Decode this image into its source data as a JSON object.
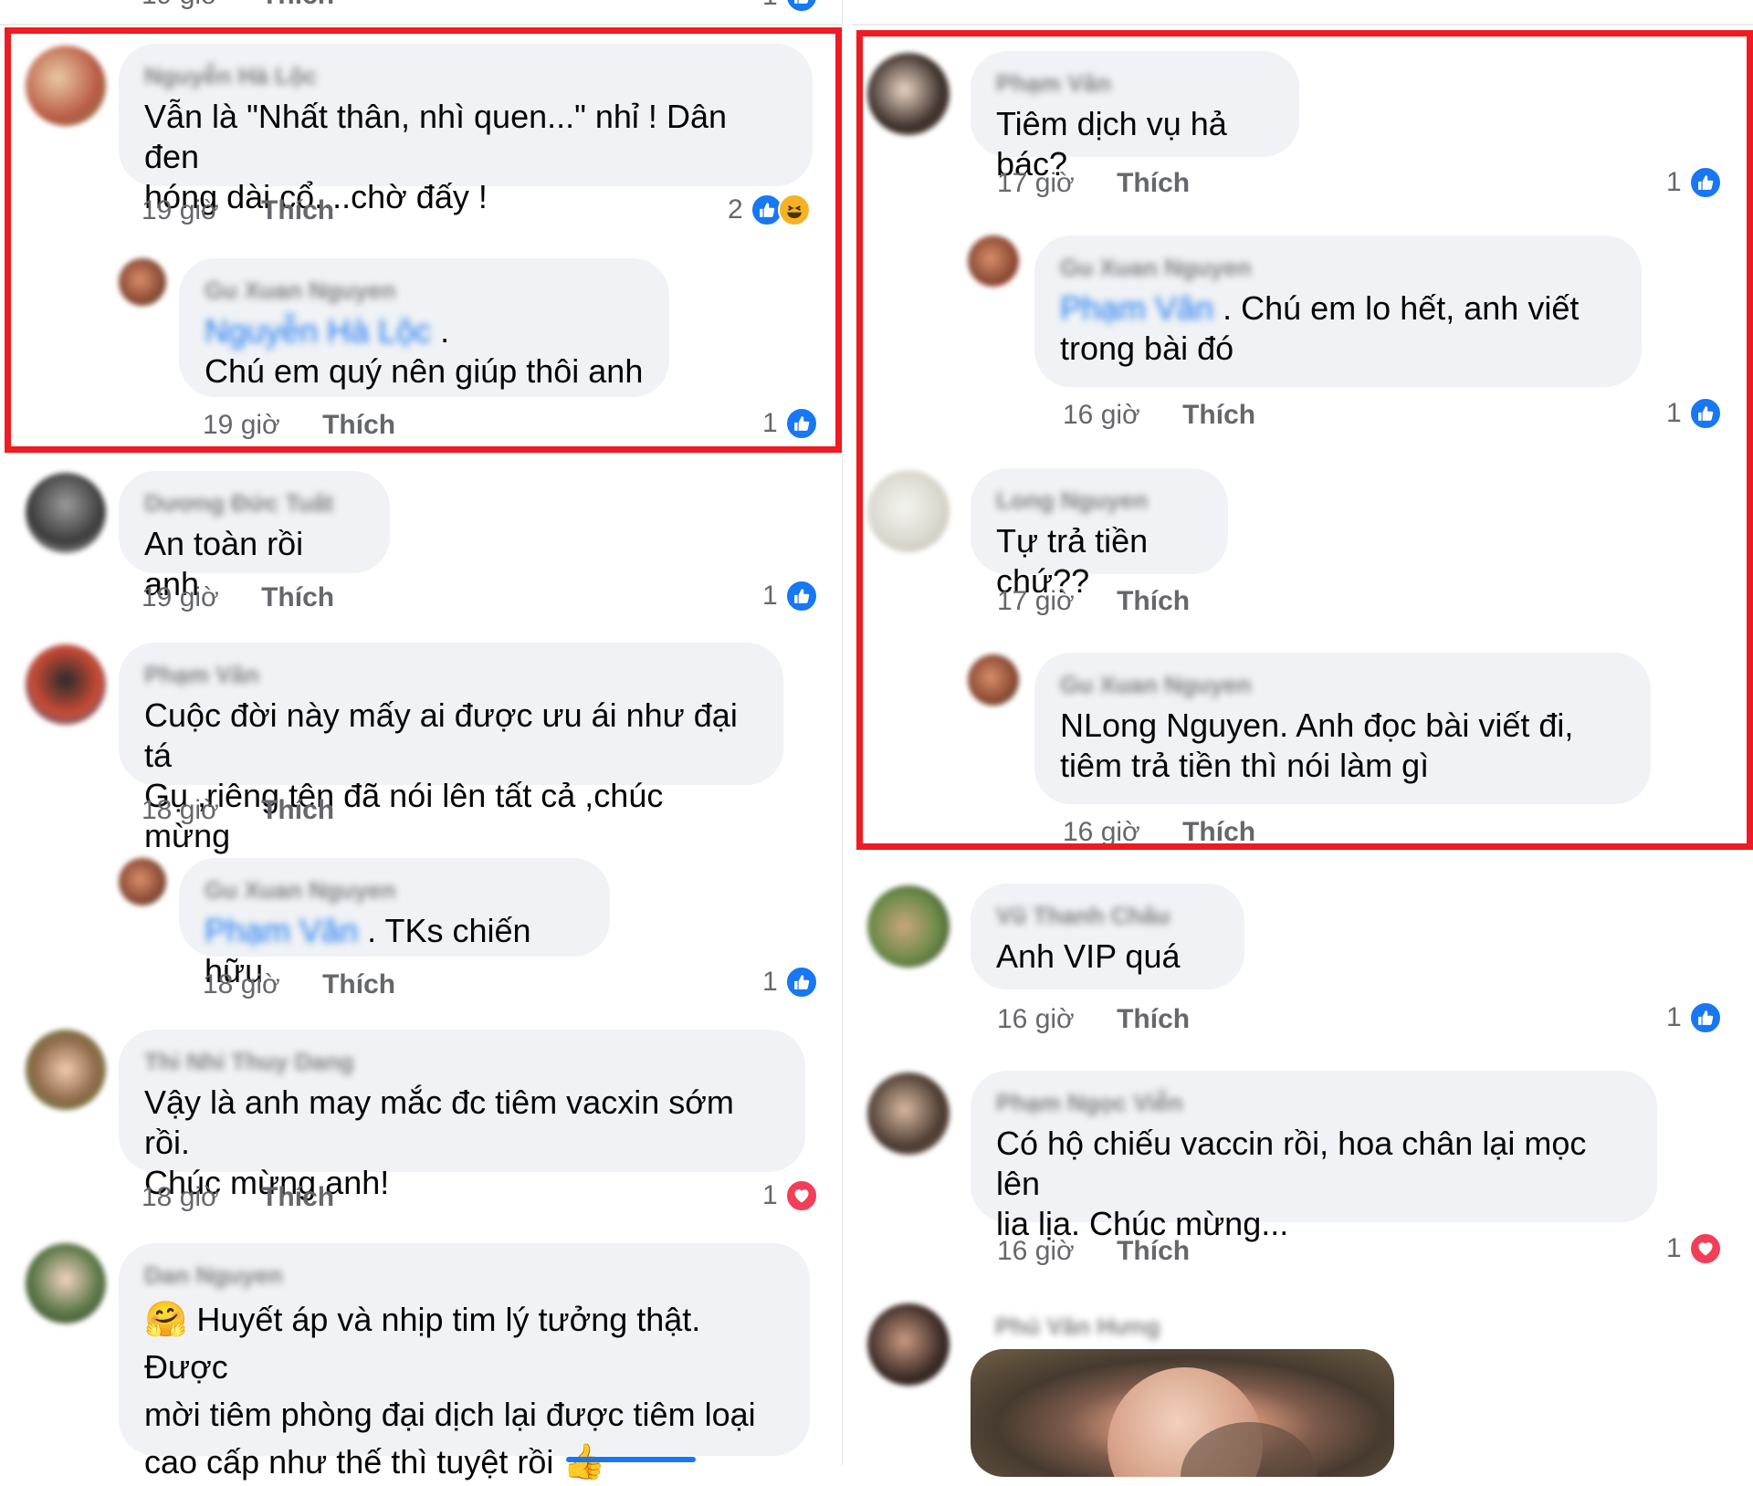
{
  "colors": {
    "highlight": "#ee1b22",
    "like_blue": "#1877f2",
    "heart_red": "#f33e58",
    "bubble_bg": "#f0f2f5",
    "meta_gray": "#65676b"
  },
  "top_partial": {
    "time": "19 giờ",
    "like": "Thích",
    "count": "1"
  },
  "left": [
    {
      "author": "Nguyễn Hà Lộc",
      "text": "Vẫn là \"Nhất thân, nhì quen...\" nhỉ ! Dân đen\nhóng dài cổ....chờ đấy !",
      "time": "19 giờ",
      "like": "Thích",
      "count": "2",
      "reactions": [
        "like-icon",
        "haha-icon"
      ]
    },
    {
      "author": "Gu Xuan Nguyen",
      "mention": "Nguyễn Hà Lộc",
      "mention_suffix": " .",
      "text": "Chú em quý nên giúp thôi anh",
      "time": "19 giờ",
      "like": "Thích",
      "count": "1",
      "reactions": [
        "like-icon"
      ]
    },
    {
      "author": "Dương Đức Tuất",
      "text": "An toàn rồi anh",
      "time": "19 giờ",
      "like": "Thích",
      "count": "1",
      "reactions": [
        "like-icon"
      ]
    },
    {
      "author": "Phạm Vân",
      "text": "Cuộc đời này mấy ai được ưu ái như đại tá\nGụ ,riêng tên đã nói lên tất cả ,chúc mừng",
      "time": "18 giờ",
      "like": "Thích"
    },
    {
      "author": "Gu Xuan Nguyen",
      "mention": "Phạm Vân",
      "text": ". TKs chiến hữu",
      "time": "18 giờ",
      "like": "Thích",
      "count": "1",
      "reactions": [
        "like-icon"
      ]
    },
    {
      "author": "Thi Nhi Thuy Dang",
      "text": "Vậy là anh may mắc đc tiêm vacxin sớm rồi.\nChúc mừng anh!",
      "time": "18 giờ",
      "like": "Thích",
      "count": "1",
      "reactions": [
        "heart-icon"
      ]
    },
    {
      "author": "Dan Nguyen",
      "emoji_start": "🤗",
      "text": " Huyết áp và nhịp tim lý tưởng thật. Được\nmời tiêm phòng đại dịch lại được tiêm loại\ncao cấp như thế thì tuyệt rồi ",
      "emoji_end": "👍"
    }
  ],
  "right": [
    {
      "author": "Phạm Vân",
      "text": "Tiêm dịch vụ hả bác?",
      "time": "17 giờ",
      "like": "Thích",
      "count": "1",
      "reactions": [
        "like-icon"
      ]
    },
    {
      "author": "Gu Xuan Nguyen",
      "mention": "Phạm Vân",
      "text": ". Chú em lo hết, anh viết\ntrong bài đó",
      "time": "16 giờ",
      "like": "Thích",
      "count": "1",
      "reactions": [
        "like-icon"
      ]
    },
    {
      "author": "Long Nguyen",
      "text": "Tự trả tiền chứ??",
      "time": "17 giờ",
      "like": "Thích"
    },
    {
      "author": "Gu Xuan Nguyen",
      "text": "NLong Nguyen. Anh đọc bài viết đi,\ntiêm trả tiền thì nói làm gì",
      "time": "16 giờ",
      "like": "Thích"
    },
    {
      "author": "Vũ Thanh Châu",
      "text": "Anh VIP quá",
      "time": "16 giờ",
      "like": "Thích",
      "count": "1",
      "reactions": [
        "like-icon"
      ]
    },
    {
      "author": "Phạm Ngọc Viễn",
      "text": "Có hộ chiếu vaccin rồi, hoa chân lại mọc lên\nlia lịa. Chúc mừng...",
      "time": "16 giờ",
      "like": "Thích",
      "count": "1",
      "reactions": [
        "heart-icon"
      ]
    },
    {
      "author": "Phú Văn Hưng"
    }
  ]
}
